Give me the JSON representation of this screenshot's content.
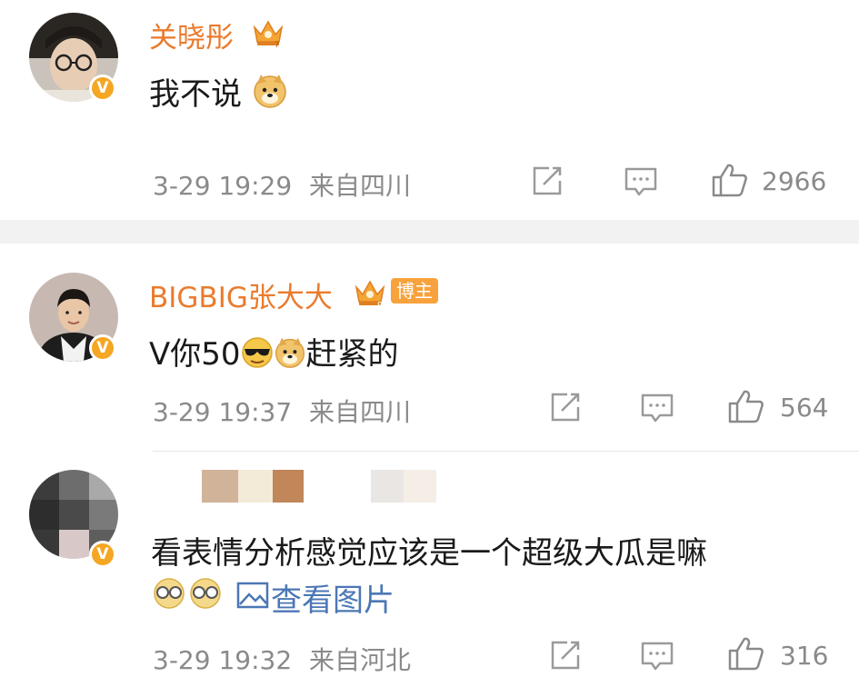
{
  "comments": [
    {
      "username": "关晓彤",
      "text": "我不说",
      "time": "3-29 19:29",
      "location": "来自四川",
      "likes": "2966"
    },
    {
      "username": "BIGBIG张大大",
      "tag": "博主",
      "text_prefix": "V你50",
      "text_suffix": "赶紧的",
      "time": "3-29 19:37",
      "location": "来自四川",
      "likes": "564"
    },
    {
      "username": "",
      "text": "看表情分析感觉应该是一个超级大瓜是嘛",
      "view_image_label": "查看图片",
      "time": "3-29 19:32",
      "location": "来自河北",
      "likes": "316"
    }
  ],
  "colors": {
    "username": "#ea7b2d",
    "meta": "#8a8a8a",
    "link": "#4b77b5",
    "badge": "#f5a623"
  },
  "icons": [
    "verified-v-icon",
    "crown-icon",
    "share-icon",
    "comment-icon",
    "like-icon",
    "doge-emoji",
    "cool-emoji",
    "image-icon"
  ]
}
